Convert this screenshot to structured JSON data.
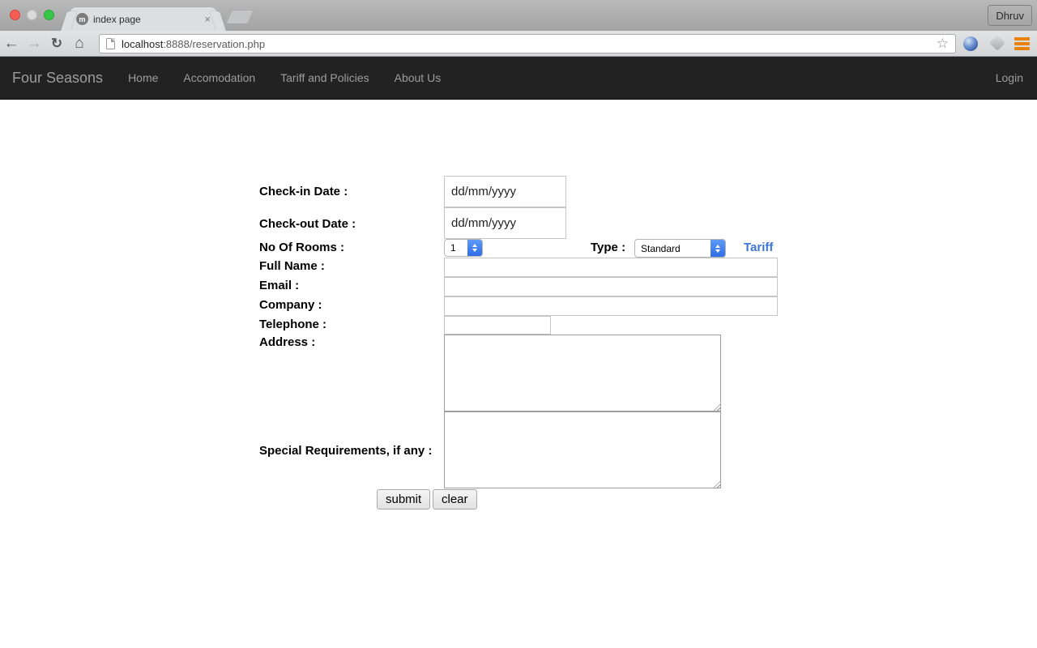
{
  "browser": {
    "tab_title": "index page",
    "tab_close": "×",
    "favicon_letter": "m",
    "profile_name": "Dhruv",
    "url_host": "localhost",
    "url_path": ":8888/reservation.php",
    "icons": {
      "back": "←",
      "forward": "→",
      "reload": "↻",
      "home": "⌂",
      "star": "☆"
    }
  },
  "navbar": {
    "brand": "Four Seasons",
    "items": [
      {
        "label": "Home"
      },
      {
        "label": "Accomodation"
      },
      {
        "label": "Tariff and Policies"
      },
      {
        "label": "About Us"
      }
    ],
    "login_label": "Login"
  },
  "form": {
    "checkin": {
      "label": "Check-in Date :",
      "value": "dd/mm/yyyy"
    },
    "checkout": {
      "label": "Check-out Date :",
      "value": "dd/mm/yyyy"
    },
    "rooms": {
      "label": "No Of Rooms :",
      "value": "1"
    },
    "type": {
      "label": "Type :",
      "value": "Standard"
    },
    "tariff_link_label": "Tariff",
    "fullname": {
      "label": "Full Name :",
      "value": ""
    },
    "email": {
      "label": "Email :",
      "value": ""
    },
    "company": {
      "label": "Company :",
      "value": ""
    },
    "telephone": {
      "label": "Telephone :",
      "value": ""
    },
    "address": {
      "label": "Address :",
      "value": ""
    },
    "special": {
      "label": "Special Requirements, if any :",
      "value": ""
    },
    "submit_label": "submit",
    "clear_label": "clear"
  },
  "colors": {
    "navbar_bg": "#222222",
    "navbar_text": "#9d9d9d",
    "link_blue": "#3b76d6",
    "select_accent_blue": "#2f6ce8",
    "menu_orange": "#e8820c",
    "traffic_red": "#f45f55",
    "traffic_gray": "#d9d9d9",
    "traffic_green": "#35c648"
  }
}
